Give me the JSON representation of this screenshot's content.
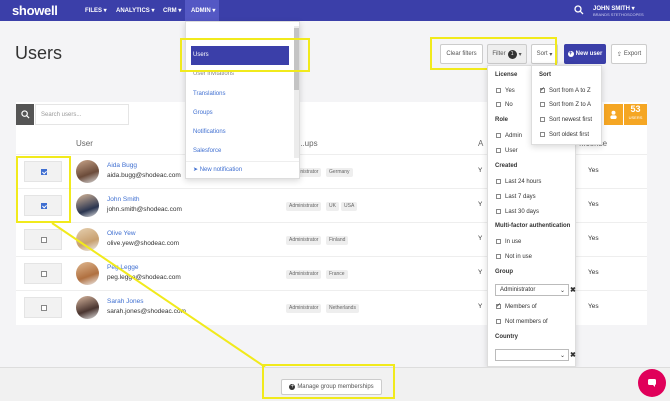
{
  "topbar": {
    "logo": "showell",
    "nav": [
      "FILES",
      "ANALYTICS",
      "CRM",
      "ADMIN"
    ],
    "user_name": "JOHN SMITH",
    "user_sub": "BRANDS STETHOSCOPES"
  },
  "page": {
    "title": "Users"
  },
  "toolbar": {
    "clear_filters": "Clear filters",
    "filter": "Filter",
    "filter_count": "1",
    "sort": "Sort",
    "new_user": "New user",
    "export": "Export"
  },
  "admin_menu": {
    "items": [
      "Users",
      "User invitations",
      "Translations",
      "Groups",
      "Notifications",
      "Salesforce",
      "New notification"
    ]
  },
  "search": {
    "placeholder": "Search users..."
  },
  "table": {
    "headers": {
      "user": "User",
      "groups": "...ups",
      "a": "A",
      "license": "...cense"
    },
    "rows": [
      {
        "name": "Aida Bugg",
        "email": "aida.bugg@shodeac.com",
        "tags": [
          "Administrator",
          "Germany"
        ],
        "col_a": "Y",
        "license": "Yes",
        "checked": true
      },
      {
        "name": "John Smith",
        "email": "john.smith@shodeac.com",
        "tags": [
          "Administrator",
          "UK",
          "USA"
        ],
        "col_a": "Y",
        "license": "Yes",
        "checked": true
      },
      {
        "name": "Olive Yew",
        "email": "olive.yew@shodeac.com",
        "tags": [
          "Administrator",
          "Finland"
        ],
        "col_a": "Y",
        "license": "Yes",
        "checked": false
      },
      {
        "name": "Peg Legge",
        "email": "peg.legge@shodeac.com",
        "tags": [
          "Administrator",
          "France"
        ],
        "col_a": "Y",
        "license": "Yes",
        "checked": false
      },
      {
        "name": "Sarah Jones",
        "email": "sarah.jones@shodeac.com",
        "tags": [
          "Administrator",
          "Netherlands"
        ],
        "col_a": "Y",
        "license": "Yes",
        "checked": false
      }
    ]
  },
  "stat_badge": {
    "value": "53",
    "label": "USERS"
  },
  "filter_panel": {
    "license": {
      "title": "License",
      "options": [
        "Yes",
        "No"
      ]
    },
    "role": {
      "title": "Role",
      "options": [
        "Admin",
        "User"
      ]
    },
    "created": {
      "title": "Created",
      "options": [
        "Last 24 hours",
        "Last 7 days",
        "Last 30 days"
      ]
    },
    "mfa": {
      "title": "Multi-factor authentication",
      "options": [
        "In use",
        "Not in use"
      ]
    },
    "group": {
      "title": "Group",
      "selected": "Administrator",
      "options": [
        "Members of",
        "Not members of"
      ]
    },
    "country": {
      "title": "Country",
      "selected": ""
    }
  },
  "sort_panel": {
    "title": "Sort",
    "options": [
      "Sort from A to Z",
      "Sort from Z to A",
      "Sort newest first",
      "Sort oldest first"
    ]
  },
  "bottom": {
    "manage_groups": "Manage group memberships"
  },
  "colors": {
    "brand": "#3b3fa9",
    "highlight": "#f1ea1c",
    "accent": "#3f6fd1",
    "badge": "#f5a623",
    "chat": "#e0005a"
  }
}
